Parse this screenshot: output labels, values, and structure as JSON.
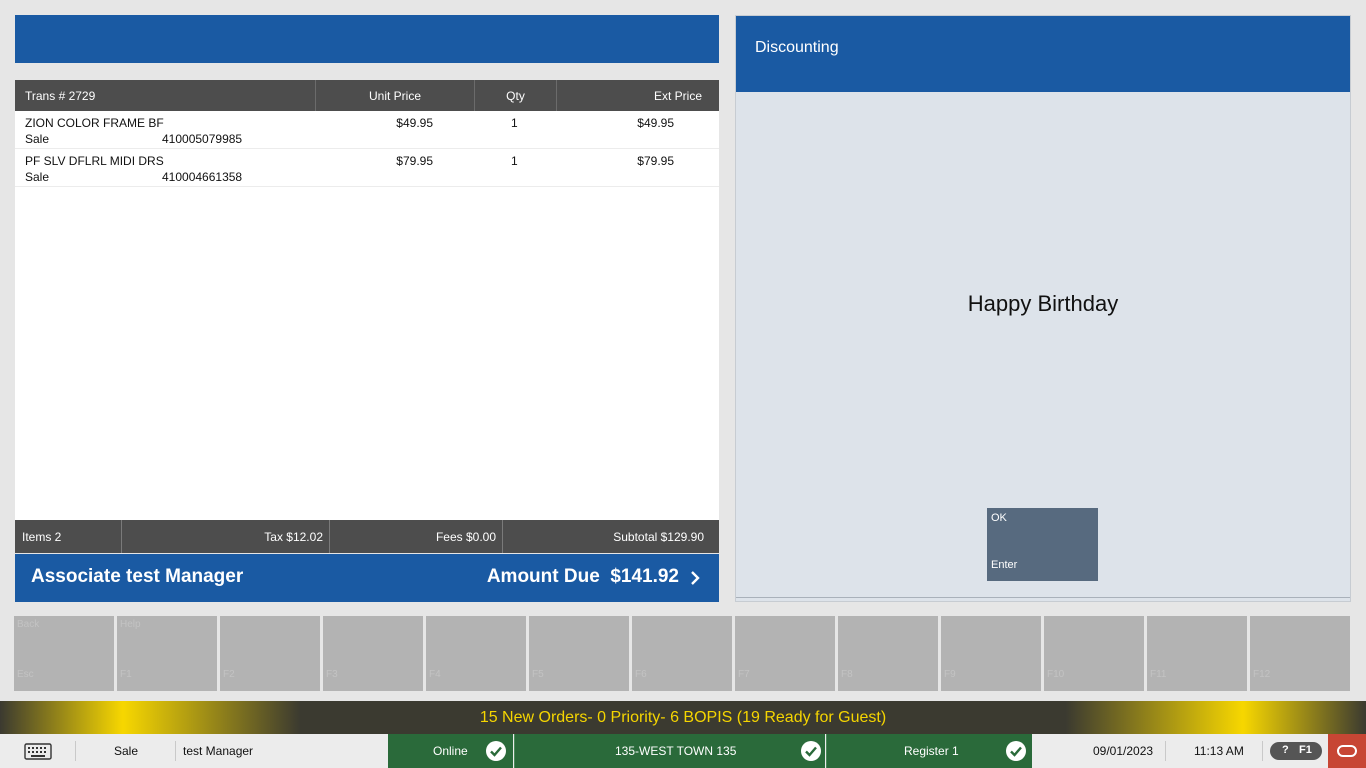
{
  "transaction": {
    "columns": {
      "trans": "Trans #  2729",
      "unit_price": "Unit Price",
      "qty": "Qty",
      "ext_price": "Ext Price"
    },
    "items": [
      {
        "description": "ZION COLOR FRAME BF",
        "type": "Sale",
        "sku": "410005079985",
        "unit_price": "$49.95",
        "qty": "1",
        "ext_price": "$49.95"
      },
      {
        "description": "PF SLV DFLRL MIDI DRS",
        "type": "Sale",
        "sku": "410004661358",
        "unit_price": "$79.95",
        "qty": "1",
        "ext_price": "$79.95"
      }
    ],
    "totals": {
      "items": "Items 2",
      "tax": "Tax $12.02",
      "fees": "Fees $0.00",
      "subtotal": "Subtotal $129.90"
    },
    "associate": "Associate test Manager",
    "amount_due": "Amount Due  $141.92"
  },
  "discount_panel": {
    "title": "Discounting",
    "message": "Happy Birthday",
    "ok_button": {
      "label": "OK",
      "key": "Enter"
    }
  },
  "function_keys": [
    {
      "label": "Back",
      "key": "Esc"
    },
    {
      "label": "Help",
      "key": "F1"
    },
    {
      "label": "",
      "key": "F2"
    },
    {
      "label": "",
      "key": "F3"
    },
    {
      "label": "",
      "key": "F4"
    },
    {
      "label": "",
      "key": "F5"
    },
    {
      "label": "",
      "key": "F6"
    },
    {
      "label": "",
      "key": "F7"
    },
    {
      "label": "",
      "key": "F8"
    },
    {
      "label": "",
      "key": "F9"
    },
    {
      "label": "",
      "key": "F10"
    },
    {
      "label": "",
      "key": "F11"
    },
    {
      "label": "",
      "key": "F12"
    }
  ],
  "notification": "15 New Orders- 0 Priority- 6 BOPIS (19 Ready for Guest)",
  "status_bar": {
    "mode": "Sale",
    "user": "test Manager",
    "online": "Online",
    "store": "135-WEST TOWN 135",
    "register": "Register 1",
    "date": "09/01/2023",
    "time": "11:13 AM",
    "help_q": "?",
    "help_key": "F1"
  },
  "icons": {
    "keyboard": "keyboard-icon",
    "check": "check-circle-icon",
    "chevron": "chevron-right-icon",
    "oracle": "oracle-logo-icon"
  },
  "colors": {
    "brand_blue": "#1a5aa3",
    "header_gray": "#4d4d4d",
    "status_green": "#2a6a3a",
    "notify_yellow": "#f5d500",
    "oracle_red": "#c74634"
  }
}
